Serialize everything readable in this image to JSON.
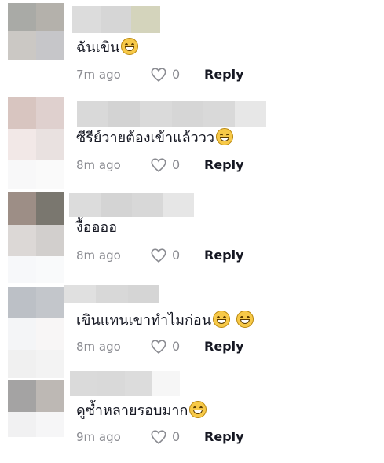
{
  "comments": [
    {
      "text": "ฉันเขิน",
      "time": "7m ago",
      "likes": "0",
      "reply_label": "Reply",
      "emojis": [
        "grinning-sweat-emoji"
      ]
    },
    {
      "text": "ซีรีย์วายต้องเข้าแล้ววว",
      "time": "8m ago",
      "likes": "0",
      "reply_label": "Reply",
      "emojis": [
        "grimacing-emoji"
      ]
    },
    {
      "text": "งื้ออออ",
      "time": "8m ago",
      "likes": "0",
      "reply_label": "Reply",
      "emojis": []
    },
    {
      "text": "เขินแทนเขาทำไมก่อน",
      "time": "8m ago",
      "likes": "0",
      "reply_label": "Reply",
      "emojis": [
        "grimacing-emoji",
        "grimacing-emoji"
      ]
    },
    {
      "text": "ดูซ้ำหลายรอบมาก",
      "time": "9m ago",
      "likes": "0",
      "reply_label": "Reply",
      "emojis": [
        "grinning-sweat-emoji"
      ]
    }
  ],
  "icons": {
    "like": "heart-outline-icon"
  },
  "colors": {
    "text": "#161823",
    "secondary": "#8a8b91",
    "emoji": "#f7c948"
  }
}
